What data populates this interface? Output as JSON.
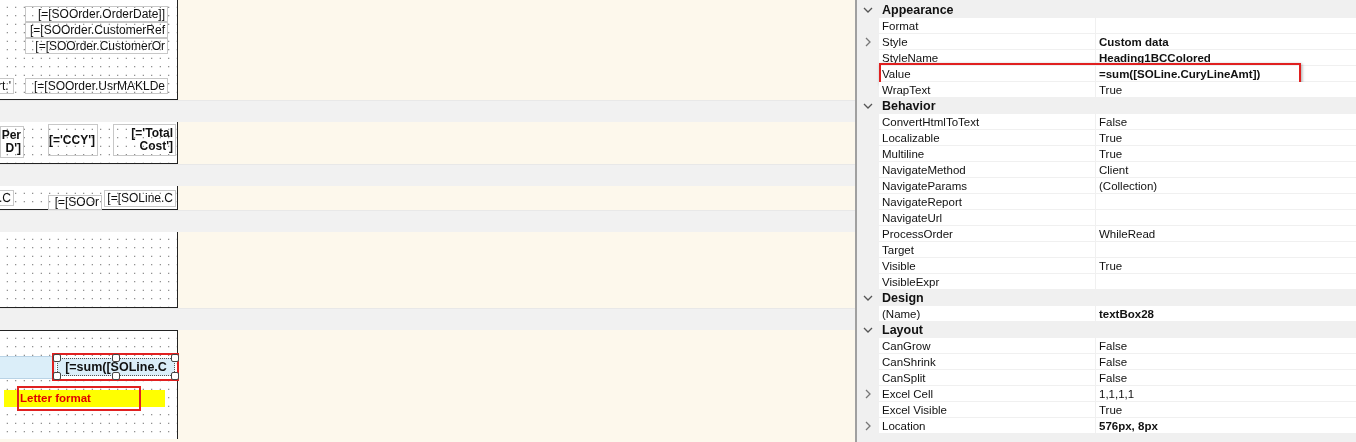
{
  "designer": {
    "bands": [
      {
        "kind": "band",
        "items": [
          {
            "kind": "field",
            "text": "[=[SOOrder.OrderDate]]",
            "selected": false,
            "annotated": false
          },
          {
            "kind": "field",
            "text": "[=[SOOrder.CustomerRef",
            "selected": false,
            "annotated": false
          },
          {
            "kind": "field",
            "text": "[=[SOOrder.CustomerOr",
            "selected": false,
            "annotated": false
          },
          {
            "kind": "field",
            "text": "rt.'",
            "selected": false,
            "annotated": false
          },
          {
            "kind": "field",
            "text": "[=[SOOrder.UsrMAKLDe",
            "selected": false,
            "annotated": false
          }
        ]
      },
      {
        "kind": "separator"
      },
      {
        "kind": "band",
        "items": [
          {
            "kind": "heading",
            "text": "Per\nD']",
            "selected": false,
            "annotated": false
          },
          {
            "kind": "heading",
            "text": "[='CCY']",
            "selected": false,
            "annotated": false
          },
          {
            "kind": "heading",
            "text": "[='Total\nCost']",
            "selected": false,
            "annotated": false
          }
        ]
      },
      {
        "kind": "separator"
      },
      {
        "kind": "band",
        "items": [
          {
            "kind": "field",
            "text": ".C",
            "selected": false,
            "annotated": false
          },
          {
            "kind": "field",
            "text": "[=[SOOr",
            "selected": false,
            "annotated": false
          },
          {
            "kind": "field",
            "text": "[=[SOLine.C",
            "selected": false,
            "annotated": false
          }
        ]
      },
      {
        "kind": "separator"
      },
      {
        "kind": "band"
      },
      {
        "kind": "separator"
      },
      {
        "kind": "band",
        "items": [
          {
            "kind": "heading",
            "text": "[=sum([SOLine.C",
            "selected": true,
            "annotated": true
          },
          {
            "kind": "note",
            "text": "Letter format",
            "selected": false,
            "annotated": true
          }
        ]
      }
    ]
  },
  "properties": [
    {
      "label": "Appearance",
      "expanded": true,
      "rows": [
        {
          "label": "Format",
          "expandable": false,
          "annotated": false
        },
        {
          "label": "Style",
          "value": "Custom data",
          "expandable": true,
          "modified": true,
          "annotated": false
        },
        {
          "label": "StyleName",
          "value": "Heading1BCColored",
          "expandable": false,
          "modified": true,
          "annotated": false
        },
        {
          "label": "Value",
          "value": "=sum([SOLine.CuryLineAmt])",
          "expandable": false,
          "modified": true,
          "annotated": true
        },
        {
          "label": "WrapText",
          "value": "True",
          "expandable": false,
          "modified": false,
          "annotated": false
        }
      ]
    },
    {
      "label": "Behavior",
      "expanded": true,
      "rows": [
        {
          "label": "ConvertHtmlToText",
          "value": "False",
          "expandable": false,
          "modified": false,
          "annotated": false
        },
        {
          "label": "Localizable",
          "value": "True",
          "expandable": false,
          "modified": false,
          "annotated": false
        },
        {
          "label": "Multiline",
          "value": "True",
          "expandable": false,
          "modified": false,
          "annotated": false
        },
        {
          "label": "NavigateMethod",
          "value": "Client",
          "expandable": false,
          "modified": false,
          "annotated": false
        },
        {
          "label": "NavigateParams",
          "value": "(Collection)",
          "expandable": false,
          "modified": false,
          "annotated": false
        },
        {
          "label": "NavigateReport",
          "expandable": false,
          "annotated": false
        },
        {
          "label": "NavigateUrl",
          "expandable": false,
          "annotated": false
        },
        {
          "label": "ProcessOrder",
          "value": "WhileRead",
          "expandable": false,
          "modified": false,
          "annotated": false
        },
        {
          "label": "Target",
          "expandable": false,
          "annotated": false
        },
        {
          "label": "Visible",
          "value": "True",
          "expandable": false,
          "modified": false,
          "annotated": false
        },
        {
          "label": "VisibleExpr",
          "expandable": false,
          "annotated": false
        }
      ]
    },
    {
      "label": "Design",
      "expanded": true,
      "rows": [
        {
          "label": "(Name)",
          "value": "textBox28",
          "expandable": false,
          "modified": true,
          "annotated": false
        }
      ]
    },
    {
      "label": "Layout",
      "expanded": true,
      "rows": [
        {
          "label": "CanGrow",
          "value": "False",
          "expandable": false,
          "modified": false,
          "annotated": false
        },
        {
          "label": "CanShrink",
          "value": "False",
          "expandable": false,
          "modified": false,
          "annotated": false
        },
        {
          "label": "CanSplit",
          "value": "False",
          "expandable": false,
          "modified": false,
          "annotated": false
        },
        {
          "label": "Excel Cell",
          "value": "1,1,1,1",
          "expandable": true,
          "modified": false,
          "annotated": false
        },
        {
          "label": "Excel Visible",
          "value": "True",
          "expandable": false,
          "modified": false,
          "annotated": false
        },
        {
          "label": "Location",
          "value": "576px, 8px",
          "expandable": true,
          "modified": true,
          "annotated": false
        }
      ]
    }
  ]
}
